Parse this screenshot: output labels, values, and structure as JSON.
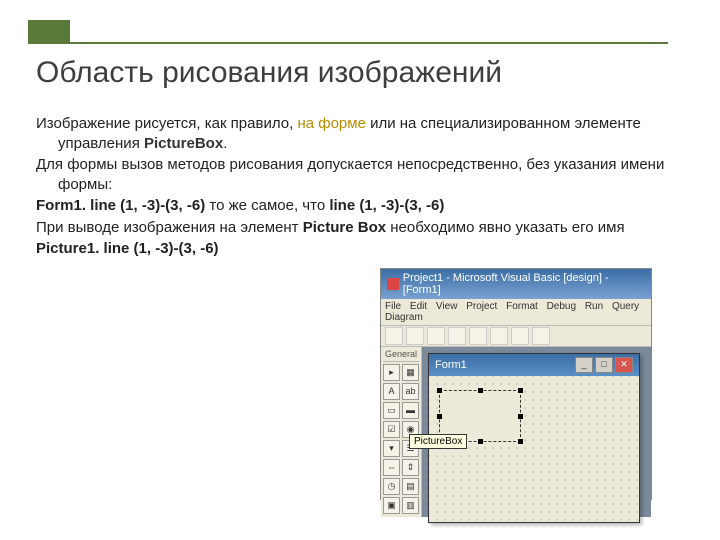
{
  "title": "Область рисования изображений",
  "body": {
    "p1a": "Изображение рисуется, как правило, ",
    "p1_hl1": "на форме",
    "p1b": " или на специализированном элементе управления ",
    "p1_ctl": "PictureBox",
    "p1c": ".",
    "p2": "Для формы вызов методов рисования допускается непосредственно, без указания имени формы:",
    "p3a": "Form1. line (1, -3)-(3, -6)",
    "p3b": " то же самое, что  ",
    "p3c": "line (1, -3)-(3, -6)",
    "p4a": "При выводе изображения на элемент ",
    "p4b": "Picture Box",
    "p4c": " необходимо явно указать его имя",
    "p5": "Picture1. line (1, -3)-(3, -6)"
  },
  "ide": {
    "title": "Project1 - Microsoft Visual Basic [design] - [Form1]",
    "menu": [
      "File",
      "Edit",
      "View",
      "Project",
      "Format",
      "Debug",
      "Run",
      "Query",
      "Diagram"
    ],
    "toolbox_label": "General",
    "form_title": "Form1",
    "tooltip": "PictureBox"
  }
}
